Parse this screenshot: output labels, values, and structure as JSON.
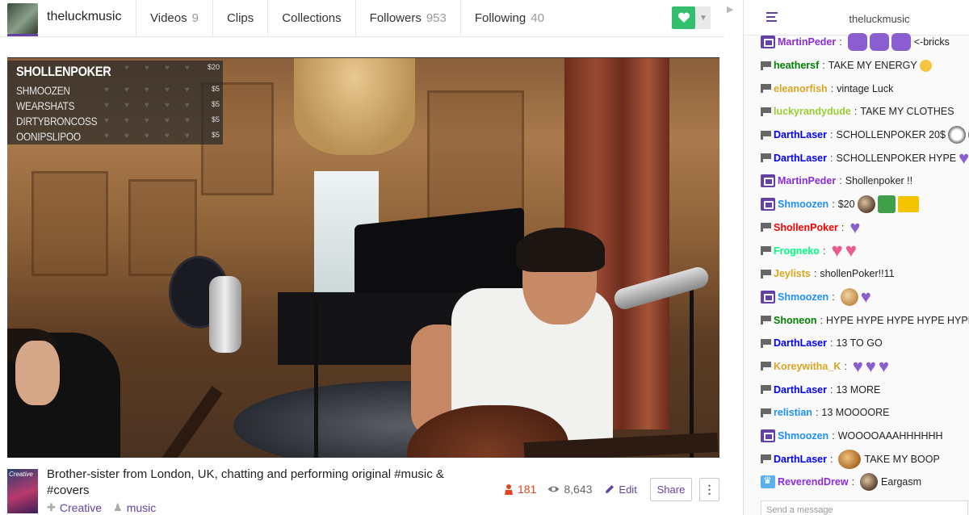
{
  "channel": {
    "name": "theluckmusic",
    "accent": "#6441a4"
  },
  "nav": {
    "tabs": [
      {
        "label": "Videos",
        "count": "9"
      },
      {
        "label": "Clips",
        "count": ""
      },
      {
        "label": "Collections",
        "count": ""
      },
      {
        "label": "Followers",
        "count": "953"
      },
      {
        "label": "Following",
        "count": "40"
      }
    ],
    "follow_icon": "heart-icon",
    "follow_color": "#34bf6f"
  },
  "video": {
    "overlay": [
      {
        "name": "SHOLLENPOKER",
        "amount": "$20"
      },
      {
        "name": "SHMOOZEN",
        "amount": "$5"
      },
      {
        "name": "WEARSHATS",
        "amount": "$5"
      },
      {
        "name": "DIRTYBRONCOSS",
        "amount": "$5"
      },
      {
        "name": "OONIPSLIPOO",
        "amount": "$5"
      }
    ]
  },
  "info": {
    "game_box_text": "Creative",
    "title": "Brother-sister from London, UK, chatting and performing original #music & #covers",
    "tags": [
      {
        "label": "Creative",
        "icon": "puzzle-icon"
      },
      {
        "label": "music",
        "icon": "community-icon"
      }
    ],
    "viewers": "181",
    "views": "8,643",
    "edit_label": "Edit",
    "share_label": "Share",
    "viewer_color": "#e2461e"
  },
  "chat": {
    "title": "theluckmusic",
    "input_placeholder": "Send a message",
    "messages": [
      {
        "badge": "sub",
        "user": "MartinPeder",
        "color": "#8a2be2",
        "text": "",
        "emotes": [
          "bubble",
          "bubble",
          "bubble"
        ],
        "trail": "<-bricks"
      },
      {
        "badge": "mod",
        "user": "heathersf",
        "color": "#008000",
        "text": "TAKE MY ENERGY",
        "emotes": [
          "smile"
        ],
        "trail": ""
      },
      {
        "badge": "mod",
        "user": "eleanorfish",
        "color": "#daa520",
        "text": "vintage Luck",
        "emotes": [],
        "trail": ""
      },
      {
        "badge": "mod",
        "user": "luckyrandydude",
        "color": "#9acd32",
        "text": "TAKE MY CLOTHES",
        "emotes": [],
        "trail": ""
      },
      {
        "badge": "mod",
        "user": "DarthLaser",
        "color": "#0000ff",
        "text": "SCHOLLENPOKER 20$",
        "emotes": [
          "panda",
          "dark"
        ],
        "trail": ""
      },
      {
        "badge": "mod",
        "user": "DarthLaser",
        "color": "#0000ff",
        "text": "SCHOLLENPOKER HYPE",
        "emotes": [
          "heart"
        ],
        "trail": ""
      },
      {
        "badge": "sub",
        "user": "MartinPeder",
        "color": "#8a2be2",
        "text": "Shollenpoker !!",
        "emotes": [],
        "trail": ""
      },
      {
        "badge": "sub",
        "user": "Shmoozen",
        "color": "#1e90ff",
        "text": "$20",
        "emotes": [
          "dark",
          "green",
          "hype"
        ],
        "trail": ""
      },
      {
        "badge": "mod",
        "user": "ShollenPoker",
        "color": "#ff0000",
        "text": "",
        "emotes": [
          "heart"
        ],
        "trail": ""
      },
      {
        "badge": "mod",
        "user": "Frogneko",
        "color": "#00ff7f",
        "text": "",
        "emotes": [
          "pinkheart",
          "pinkheart"
        ],
        "trail": ""
      },
      {
        "badge": "mod",
        "user": "Jeylists",
        "color": "#daa520",
        "text": "shollenPoker!!11",
        "emotes": [],
        "trail": ""
      },
      {
        "badge": "sub",
        "user": "Shmoozen",
        "color": "#1e90ff",
        "text": "",
        "emotes": [
          "face",
          "heart"
        ],
        "trail": ""
      },
      {
        "badge": "mod",
        "user": "Shoneon",
        "color": "#008000",
        "text": "HYPE HYPE HYPE HYPE HYPE",
        "emotes": [],
        "trail": ""
      },
      {
        "badge": "mod",
        "user": "DarthLaser",
        "color": "#0000ff",
        "text": "13 TO GO",
        "emotes": [],
        "trail": ""
      },
      {
        "badge": "mod",
        "user": "Koreywitha_K",
        "color": "#daa520",
        "text": "",
        "emotes": [
          "heart",
          "heart",
          "heart"
        ],
        "trail": ""
      },
      {
        "badge": "mod",
        "user": "DarthLaser",
        "color": "#0000ff",
        "text": "13 MORE",
        "emotes": [],
        "trail": ""
      },
      {
        "badge": "mod",
        "user": "relistian",
        "color": "#1e90ff",
        "text": "13 MOOOORE",
        "emotes": [],
        "trail": ""
      },
      {
        "badge": "sub",
        "user": "Shmoozen",
        "color": "#1e90ff",
        "text": "WOOOOAAAHHHHHH",
        "emotes": [],
        "trail": ""
      },
      {
        "badge": "mod",
        "user": "DarthLaser",
        "color": "#0000ff",
        "text": "",
        "emotes": [
          "boop"
        ],
        "trail": "TAKE MY BOOP"
      },
      {
        "badge": "crown",
        "user": "ReverendDrew",
        "color": "#8a2be2",
        "text": "",
        "emotes": [
          "dark"
        ],
        "trail": "Eargasm"
      }
    ]
  }
}
